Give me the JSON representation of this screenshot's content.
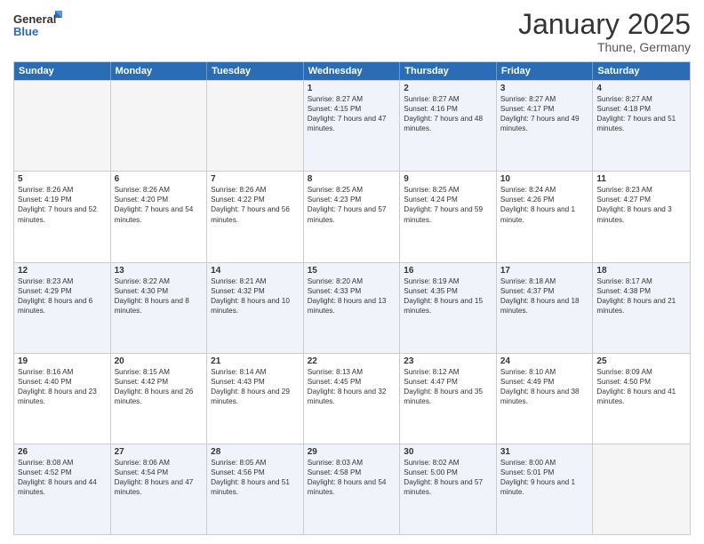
{
  "logo": {
    "line1": "General",
    "line2": "Blue"
  },
  "header": {
    "month": "January 2025",
    "location": "Thune, Germany"
  },
  "days": [
    "Sunday",
    "Monday",
    "Tuesday",
    "Wednesday",
    "Thursday",
    "Friday",
    "Saturday"
  ],
  "rows": [
    [
      {
        "day": "",
        "text": ""
      },
      {
        "day": "",
        "text": ""
      },
      {
        "day": "",
        "text": ""
      },
      {
        "day": "1",
        "text": "Sunrise: 8:27 AM\nSunset: 4:15 PM\nDaylight: 7 hours and 47 minutes."
      },
      {
        "day": "2",
        "text": "Sunrise: 8:27 AM\nSunset: 4:16 PM\nDaylight: 7 hours and 48 minutes."
      },
      {
        "day": "3",
        "text": "Sunrise: 8:27 AM\nSunset: 4:17 PM\nDaylight: 7 hours and 49 minutes."
      },
      {
        "day": "4",
        "text": "Sunrise: 8:27 AM\nSunset: 4:18 PM\nDaylight: 7 hours and 51 minutes."
      }
    ],
    [
      {
        "day": "5",
        "text": "Sunrise: 8:26 AM\nSunset: 4:19 PM\nDaylight: 7 hours and 52 minutes."
      },
      {
        "day": "6",
        "text": "Sunrise: 8:26 AM\nSunset: 4:20 PM\nDaylight: 7 hours and 54 minutes."
      },
      {
        "day": "7",
        "text": "Sunrise: 8:26 AM\nSunset: 4:22 PM\nDaylight: 7 hours and 56 minutes."
      },
      {
        "day": "8",
        "text": "Sunrise: 8:25 AM\nSunset: 4:23 PM\nDaylight: 7 hours and 57 minutes."
      },
      {
        "day": "9",
        "text": "Sunrise: 8:25 AM\nSunset: 4:24 PM\nDaylight: 7 hours and 59 minutes."
      },
      {
        "day": "10",
        "text": "Sunrise: 8:24 AM\nSunset: 4:26 PM\nDaylight: 8 hours and 1 minute."
      },
      {
        "day": "11",
        "text": "Sunrise: 8:23 AM\nSunset: 4:27 PM\nDaylight: 8 hours and 3 minutes."
      }
    ],
    [
      {
        "day": "12",
        "text": "Sunrise: 8:23 AM\nSunset: 4:29 PM\nDaylight: 8 hours and 6 minutes."
      },
      {
        "day": "13",
        "text": "Sunrise: 8:22 AM\nSunset: 4:30 PM\nDaylight: 8 hours and 8 minutes."
      },
      {
        "day": "14",
        "text": "Sunrise: 8:21 AM\nSunset: 4:32 PM\nDaylight: 8 hours and 10 minutes."
      },
      {
        "day": "15",
        "text": "Sunrise: 8:20 AM\nSunset: 4:33 PM\nDaylight: 8 hours and 13 minutes."
      },
      {
        "day": "16",
        "text": "Sunrise: 8:19 AM\nSunset: 4:35 PM\nDaylight: 8 hours and 15 minutes."
      },
      {
        "day": "17",
        "text": "Sunrise: 8:18 AM\nSunset: 4:37 PM\nDaylight: 8 hours and 18 minutes."
      },
      {
        "day": "18",
        "text": "Sunrise: 8:17 AM\nSunset: 4:38 PM\nDaylight: 8 hours and 21 minutes."
      }
    ],
    [
      {
        "day": "19",
        "text": "Sunrise: 8:16 AM\nSunset: 4:40 PM\nDaylight: 8 hours and 23 minutes."
      },
      {
        "day": "20",
        "text": "Sunrise: 8:15 AM\nSunset: 4:42 PM\nDaylight: 8 hours and 26 minutes."
      },
      {
        "day": "21",
        "text": "Sunrise: 8:14 AM\nSunset: 4:43 PM\nDaylight: 8 hours and 29 minutes."
      },
      {
        "day": "22",
        "text": "Sunrise: 8:13 AM\nSunset: 4:45 PM\nDaylight: 8 hours and 32 minutes."
      },
      {
        "day": "23",
        "text": "Sunrise: 8:12 AM\nSunset: 4:47 PM\nDaylight: 8 hours and 35 minutes."
      },
      {
        "day": "24",
        "text": "Sunrise: 8:10 AM\nSunset: 4:49 PM\nDaylight: 8 hours and 38 minutes."
      },
      {
        "day": "25",
        "text": "Sunrise: 8:09 AM\nSunset: 4:50 PM\nDaylight: 8 hours and 41 minutes."
      }
    ],
    [
      {
        "day": "26",
        "text": "Sunrise: 8:08 AM\nSunset: 4:52 PM\nDaylight: 8 hours and 44 minutes."
      },
      {
        "day": "27",
        "text": "Sunrise: 8:06 AM\nSunset: 4:54 PM\nDaylight: 8 hours and 47 minutes."
      },
      {
        "day": "28",
        "text": "Sunrise: 8:05 AM\nSunset: 4:56 PM\nDaylight: 8 hours and 51 minutes."
      },
      {
        "day": "29",
        "text": "Sunrise: 8:03 AM\nSunset: 4:58 PM\nDaylight: 8 hours and 54 minutes."
      },
      {
        "day": "30",
        "text": "Sunrise: 8:02 AM\nSunset: 5:00 PM\nDaylight: 8 hours and 57 minutes."
      },
      {
        "day": "31",
        "text": "Sunrise: 8:00 AM\nSunset: 5:01 PM\nDaylight: 9 hours and 1 minute."
      },
      {
        "day": "",
        "text": ""
      }
    ]
  ],
  "alt_rows": [
    0,
    2,
    4
  ]
}
